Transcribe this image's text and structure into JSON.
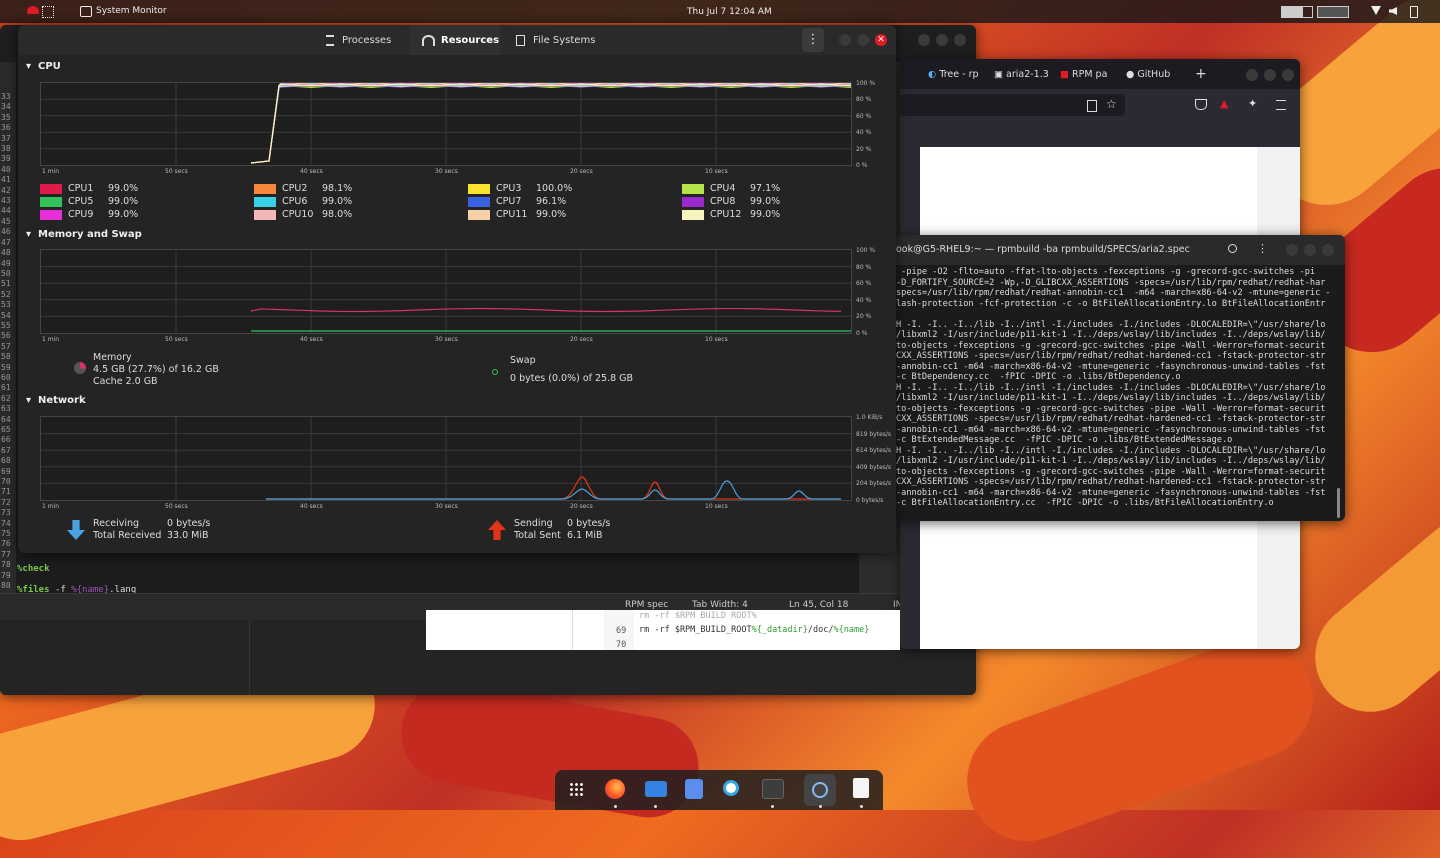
{
  "topbar": {
    "app": "System Monitor",
    "clock": "Thu Jul 7 12:04 AM"
  },
  "colors": {
    "accent": "#e01b24",
    "cpu_line": "#f66151"
  },
  "sysmon": {
    "tabs": [
      {
        "label": "Processes",
        "icon": "processes-icon"
      },
      {
        "label": "Resources",
        "icon": "resources-icon"
      },
      {
        "label": "File Systems",
        "icon": "filesystems-icon"
      }
    ],
    "cpu": {
      "title": "CPU",
      "x_ticks": [
        "1 min",
        "50 secs",
        "40 secs",
        "30 secs",
        "20 secs",
        "10 secs"
      ],
      "y_ticks": [
        "100 %",
        "80 %",
        "60 %",
        "40 %",
        "20 %",
        "0 %"
      ],
      "cpus": [
        {
          "name": "CPU1",
          "value": "99.0%",
          "color": "#e01b4a"
        },
        {
          "name": "CPU2",
          "value": "98.1%",
          "color": "#f5883a"
        },
        {
          "name": "CPU3",
          "value": "100.0%",
          "color": "#f8e32e"
        },
        {
          "name": "CPU4",
          "value": "97.1%",
          "color": "#b7e34a"
        },
        {
          "name": "CPU5",
          "value": "99.0%",
          "color": "#33c25a"
        },
        {
          "name": "CPU6",
          "value": "99.0%",
          "color": "#3ad0e8"
        },
        {
          "name": "CPU7",
          "value": "96.1%",
          "color": "#3a62e0"
        },
        {
          "name": "CPU8",
          "value": "99.0%",
          "color": "#9a2ad0"
        },
        {
          "name": "CPU9",
          "value": "99.0%",
          "color": "#e62fd8"
        },
        {
          "name": "CPU10",
          "value": "98.0%",
          "color": "#f4b8b8"
        },
        {
          "name": "CPU11",
          "value": "99.0%",
          "color": "#f7d0a8"
        },
        {
          "name": "CPU12",
          "value": "99.0%",
          "color": "#f8f4c0"
        }
      ]
    },
    "memory": {
      "title": "Memory and Swap",
      "x_ticks": [
        "1 min",
        "50 secs",
        "40 secs",
        "30 secs",
        "20 secs",
        "10 secs"
      ],
      "y_ticks": [
        "100 %",
        "80 %",
        "60 %",
        "40 %",
        "20 %",
        "0 %"
      ],
      "mem_label": "Memory",
      "mem_used": "4.5 GB (27.7%) of 16.2 GB",
      "mem_cache": "Cache 2.0 GB",
      "mem_fraction": 0.277,
      "swap_label": "Swap",
      "swap_used": "0 bytes (0.0%) of 25.8 GB"
    },
    "network": {
      "title": "Network",
      "x_ticks": [
        "1 min",
        "50 secs",
        "40 secs",
        "30 secs",
        "20 secs",
        "10 secs"
      ],
      "y_ticks": [
        "1.0 KiB/s",
        "819 bytes/s",
        "614 bytes/s",
        "409 bytes/s",
        "204 bytes/s",
        "0 bytes/s"
      ],
      "recv_label": "Receiving",
      "recv_rate": "0 bytes/s",
      "total_recv_label": "Total Received",
      "total_recv": "33.0 MiB",
      "send_label": "Sending",
      "send_rate": "0 bytes/s",
      "total_sent_label": "Total Sent",
      "total_sent": "6.1 MiB"
    }
  },
  "editor": {
    "line_numbers": [
      "33",
      "34",
      "35",
      "36",
      "37",
      "38",
      "39",
      "40",
      "41",
      "42",
      "43",
      "44",
      "45",
      "46",
      "47",
      "48",
      "49",
      "50",
      "51",
      "52",
      "53",
      "54",
      "55",
      "56",
      "57",
      "58",
      "59",
      "60",
      "61",
      "62",
      "63",
      "64",
      "65",
      "66",
      "67",
      "68",
      "69",
      "70",
      "71",
      "72",
      "73",
      "74",
      "75",
      "76",
      "77",
      "78",
      "79",
      "80"
    ],
    "check_kw": "%check",
    "files_kw": "%files",
    "files_flag": "-f",
    "files_var": "%{name}",
    "files_rest": ".lang",
    "status": {
      "lang": "RPM spec",
      "tab": "Tab Width: 4",
      "pos": "Ln 45, Col 18",
      "mode": "INS"
    }
  },
  "editor2": {
    "partial_line": "rm -rf $RPM_BUILD_ROOT%{_datadir}/locale/local.alias",
    "line69_num": "69",
    "line69_a": "rm -rf $RPM_BUILD_ROOT",
    "line69_b": "%{_datadir}",
    "line69_c": "/doc/",
    "line69_d": "%{name}",
    "line70_num": "70"
  },
  "browser": {
    "tabs": [
      "Tree - rp",
      "aria2-1.3",
      "RPM pa",
      "GitHub"
    ]
  },
  "terminal": {
    "title": "ook@G5-RHEL9:~ — rpmbuild -ba rpmbuild/SPECS/aria2.spec",
    "lines": [
      " -pipe -O2 -flto=auto -ffat-lto-objects -fexceptions -g -grecord-gcc-switches -pi",
      "-D_FORTIFY_SOURCE=2 -Wp,-D_GLIBCXX_ASSERTIONS -specs=/usr/lib/rpm/redhat/redhat-har",
      "specs=/usr/lib/rpm/redhat/redhat-annobin-cc1  -m64 -march=x86-64-v2 -mtune=generic -",
      "lash-protection -fcf-protection -c -o BtFileAllocationEntry.lo BtFileAllocationEntr",
      "",
      "H -I. -I.. -I../lib -I../intl -I./includes -I./includes -DLOCALEDIR=\\\"/usr/share/lo",
      "/libxml2 -I/usr/include/p11-kit-1 -I../deps/wslay/lib/includes -I../deps/wslay/lib/",
      "to-objects -fexceptions -g -grecord-gcc-switches -pipe -Wall -Werror=format-securit",
      "CXX_ASSERTIONS -specs=/usr/lib/rpm/redhat/redhat-hardened-cc1 -fstack-protector-str",
      "-annobin-cc1 -m64 -march=x86-64-v2 -mtune=generic -fasynchronous-unwind-tables -fst",
      "-c BtDependency.cc  -fPIC -DPIC -o .libs/BtDependency.o",
      "H -I. -I.. -I../lib -I../intl -I./includes -I./includes -DLOCALEDIR=\\\"/usr/share/lo",
      "/libxml2 -I/usr/include/p11-kit-1 -I../deps/wslay/lib/includes -I../deps/wslay/lib/",
      "to-objects -fexceptions -g -grecord-gcc-switches -pipe -Wall -Werror=format-securit",
      "CXX_ASSERTIONS -specs=/usr/lib/rpm/redhat/redhat-hardened-cc1 -fstack-protector-str",
      "-annobin-cc1 -m64 -march=x86-64-v2 -mtune=generic -fasynchronous-unwind-tables -fst",
      "-c BtExtendedMessage.cc  -fPIC -DPIC -o .libs/BtExtendedMessage.o",
      "H -I. -I.. -I../lib -I../intl -I./includes -I./includes -DLOCALEDIR=\\\"/usr/share/lo",
      "/libxml2 -I/usr/include/p11-kit-1 -I../deps/wslay/lib/includes -I../deps/wslay/lib/",
      "to-objects -fexceptions -g -grecord-gcc-switches -pipe -Wall -Werror=format-securit",
      "CXX_ASSERTIONS -specs=/usr/lib/rpm/redhat/redhat-hardened-cc1 -fstack-protector-str",
      "-annobin-cc1 -m64 -march=x86-64-v2 -mtune=generic -fasynchronous-unwind-tables -fst",
      "-c BtFileAllocationEntry.cc  -fPIC -DPIC -o .libs/BtFileAllocationEntry.o"
    ]
  }
}
